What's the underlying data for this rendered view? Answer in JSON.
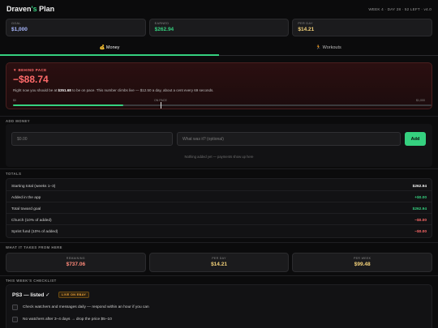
{
  "header": {
    "title_name": "Draven",
    "title_apos": "'s",
    "title_rest": " Plan",
    "week_info": "WEEK 4 · DAY 28 · 52 LEFT · v4.0"
  },
  "stats": [
    {
      "label": "GOAL",
      "value": "$1,000",
      "color": "#a9b8ff"
    },
    {
      "label": "EARNED",
      "value": "$262.94",
      "color": "#35d07f"
    },
    {
      "label": "PER DAY",
      "value": "$14.21",
      "color": "#f5d37a"
    }
  ],
  "tabs": [
    {
      "label": "💰 Money"
    },
    {
      "label": "🏃 Workouts"
    }
  ],
  "pace": {
    "status": "▼ BEHIND PACE",
    "amount": "−$88.74",
    "desc_pre": "Right now you should be at ",
    "desc_bold": "$351.68",
    "desc_post": " to be on pace. This number climbs live — $12.50 a day, about a cent every 69 seconds.",
    "tick_start": "$0",
    "tick_mid": "ON PACE",
    "tick_end": "$1,000",
    "progress": 0.263,
    "marker": 0.352
  },
  "add_money": {
    "section_title": "ADD MONEY",
    "amount_placeholder": "$0.00",
    "note_placeholder": "What was it? (optional)",
    "button_label": "Add",
    "empty_note": "Nothing added yet — payments show up here"
  },
  "totals": {
    "section_title": "TOTALS",
    "rows": [
      {
        "label": "Starting total (weeks 1–3)",
        "value": "$262.94",
        "color": "#f2f2f2"
      },
      {
        "label": "Added in the app",
        "value": "+$0.00",
        "color": "#35d07f"
      },
      {
        "label": "Total toward goal",
        "value": "$262.94",
        "color": "#35d07f"
      },
      {
        "label": "Church (10% of added)",
        "value": "−$0.00",
        "color": "#ff6a6a"
      },
      {
        "label": "Sprint fund (10% of added)",
        "value": "−$0.00",
        "color": "#ff6a6a"
      }
    ]
  },
  "takes": {
    "section_title": "WHAT IT TAKES FROM HERE",
    "cards": [
      {
        "label": "REMAINING",
        "value": "$737.06",
        "color": "#ff8a7a"
      },
      {
        "label": "PER DAY",
        "value": "$14.21",
        "color": "#f5d37a"
      },
      {
        "label": "PER WEEK",
        "value": "$99.48",
        "color": "#f5d37a"
      }
    ]
  },
  "checklist": {
    "section_title": "THIS WEEK'S CHECKLIST",
    "item_title": "PS3 — listed ✓",
    "badge": "LIVE ON EBAY",
    "tasks": [
      {
        "text": "Check watchers and messages daily — respond within an hour if you can"
      },
      {
        "text": "No watchers after 3–4 days → drop the price $5–10"
      }
    ]
  }
}
